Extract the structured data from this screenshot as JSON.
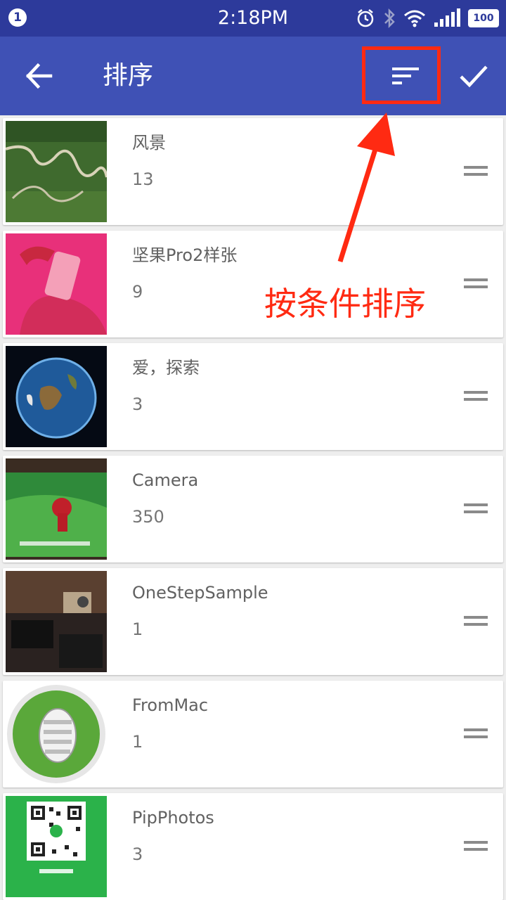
{
  "status_bar": {
    "notification_count": "1",
    "time": "2:18PM",
    "battery": "100",
    "icons": [
      "alarm-icon",
      "bluetooth-icon",
      "wifi-icon",
      "signal-icon",
      "battery-icon"
    ]
  },
  "app_bar": {
    "title": "排序",
    "back_icon": "arrow-left-icon",
    "sort_icon": "sort-lines-icon",
    "confirm_icon": "check-icon"
  },
  "annotation": {
    "text": "按条件排序",
    "color": "#ff2a12"
  },
  "albums": [
    {
      "name": "风景",
      "count": "13",
      "thumb": "winding-road-landscape"
    },
    {
      "name": "坚果Pro2样张",
      "count": "9",
      "thumb": "pink-phone-photo"
    },
    {
      "name": "爱，探索",
      "count": "3",
      "thumb": "earth-globe"
    },
    {
      "name": "Camera",
      "count": "350",
      "thumb": "tv-screen-photo"
    },
    {
      "name": "OneStepSample",
      "count": "1",
      "thumb": "desk-devices-photo"
    },
    {
      "name": "FromMac",
      "count": "1",
      "thumb": "grass-circle-logo"
    },
    {
      "name": "PipPhotos",
      "count": "3",
      "thumb": "qr-code"
    }
  ],
  "colors": {
    "status_bar": "#2d3a9b",
    "app_bar": "#3f51b5",
    "accent_red": "#ff2a12"
  }
}
